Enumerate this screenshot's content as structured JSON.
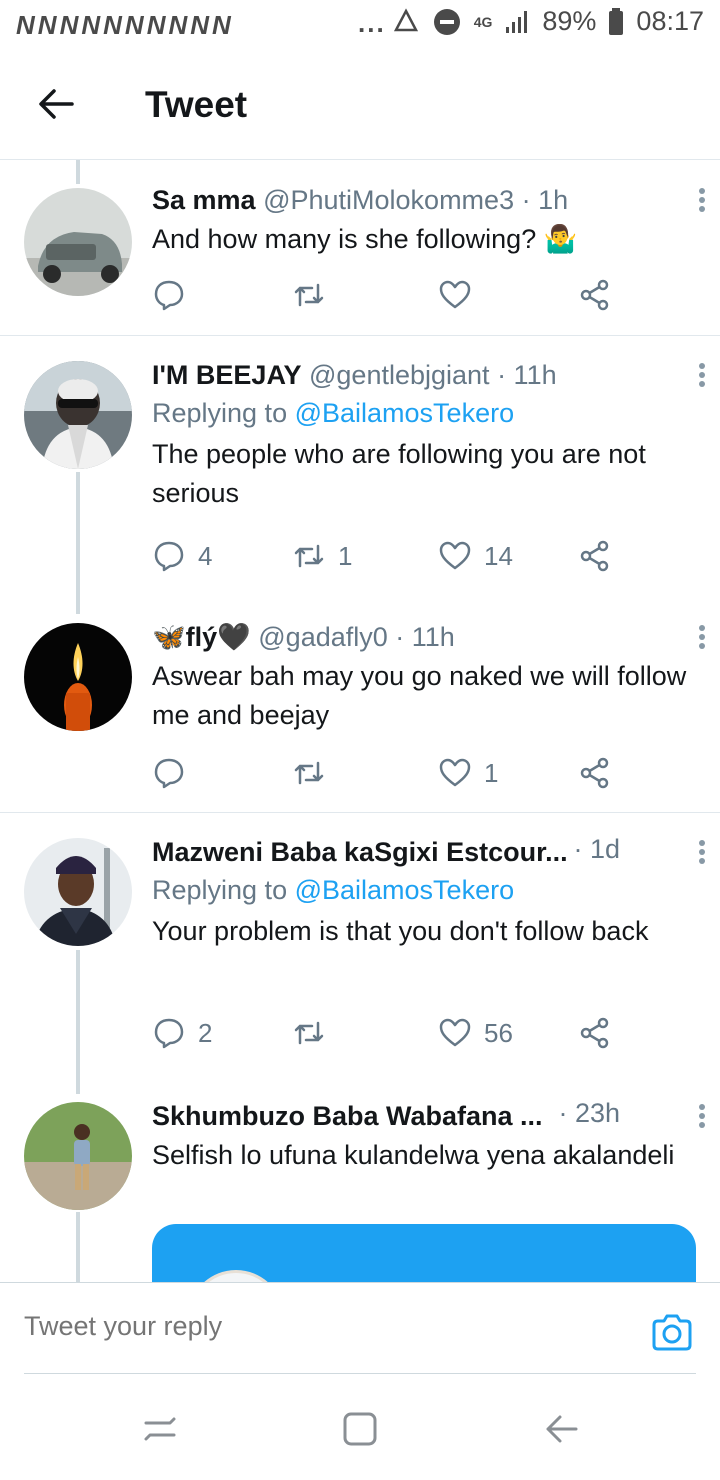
{
  "status_bar": {
    "notifications": [
      "N",
      "N",
      "N",
      "N",
      "N",
      "N",
      "N",
      "N",
      "N",
      "N"
    ],
    "more": "...",
    "network": "4G",
    "battery": "89%",
    "time": "08:17"
  },
  "header": {
    "title": "Tweet"
  },
  "tweets": [
    {
      "name": "Sa mma",
      "handle": "@PhutiMolokomme3",
      "time": "· 1h",
      "reply_to_prefix": "",
      "reply_to": "",
      "text": "And how many is she following? 🤷‍♂️",
      "replies": "",
      "retweets": "",
      "likes": ""
    },
    {
      "name": "I'M BEEJAY",
      "handle": "@gentlebjgiant",
      "time": "· 11h",
      "reply_to_prefix": "Replying to ",
      "reply_to": "@BailamosTekero",
      "text": "The people who are following you are not serious",
      "replies": "4",
      "retweets": "1",
      "likes": "14"
    },
    {
      "name": "🦋flý🖤",
      "handle": "@gadafly0",
      "time": "· 11h",
      "reply_to_prefix": "",
      "reply_to": "",
      "text": "Aswear bah may you go naked we will follow me and beejay",
      "replies": "",
      "retweets": "",
      "likes": "1"
    },
    {
      "name": "Mazweni Baba kaSgixi Estcour...",
      "handle": "",
      "time": "· 1d",
      "reply_to_prefix": "Replying to ",
      "reply_to": "@BailamosTekero",
      "text": "Your problem is that you don't follow back",
      "replies": "2",
      "retweets": "",
      "likes": "56"
    },
    {
      "name": "Skhumbuzo Baba Wabafana ...",
      "handle": "",
      "time": "· 23h",
      "reply_to_prefix": "",
      "reply_to": "",
      "text": "Selfish lo ufuna kulandelwa yena akalandeli",
      "replies": "",
      "retweets": "",
      "likes": ""
    }
  ],
  "reply_bar": {
    "placeholder": "Tweet your reply"
  },
  "icons": {
    "back": "arrow-left-icon",
    "reply": "reply-icon",
    "retweet": "retweet-icon",
    "like": "heart-icon",
    "share": "share-icon",
    "more": "more-vertical-icon",
    "camera": "camera-icon"
  },
  "colors": {
    "accent": "#1da1f2",
    "text": "#14171a",
    "muted": "#657786",
    "divider": "#e1e8ed"
  }
}
